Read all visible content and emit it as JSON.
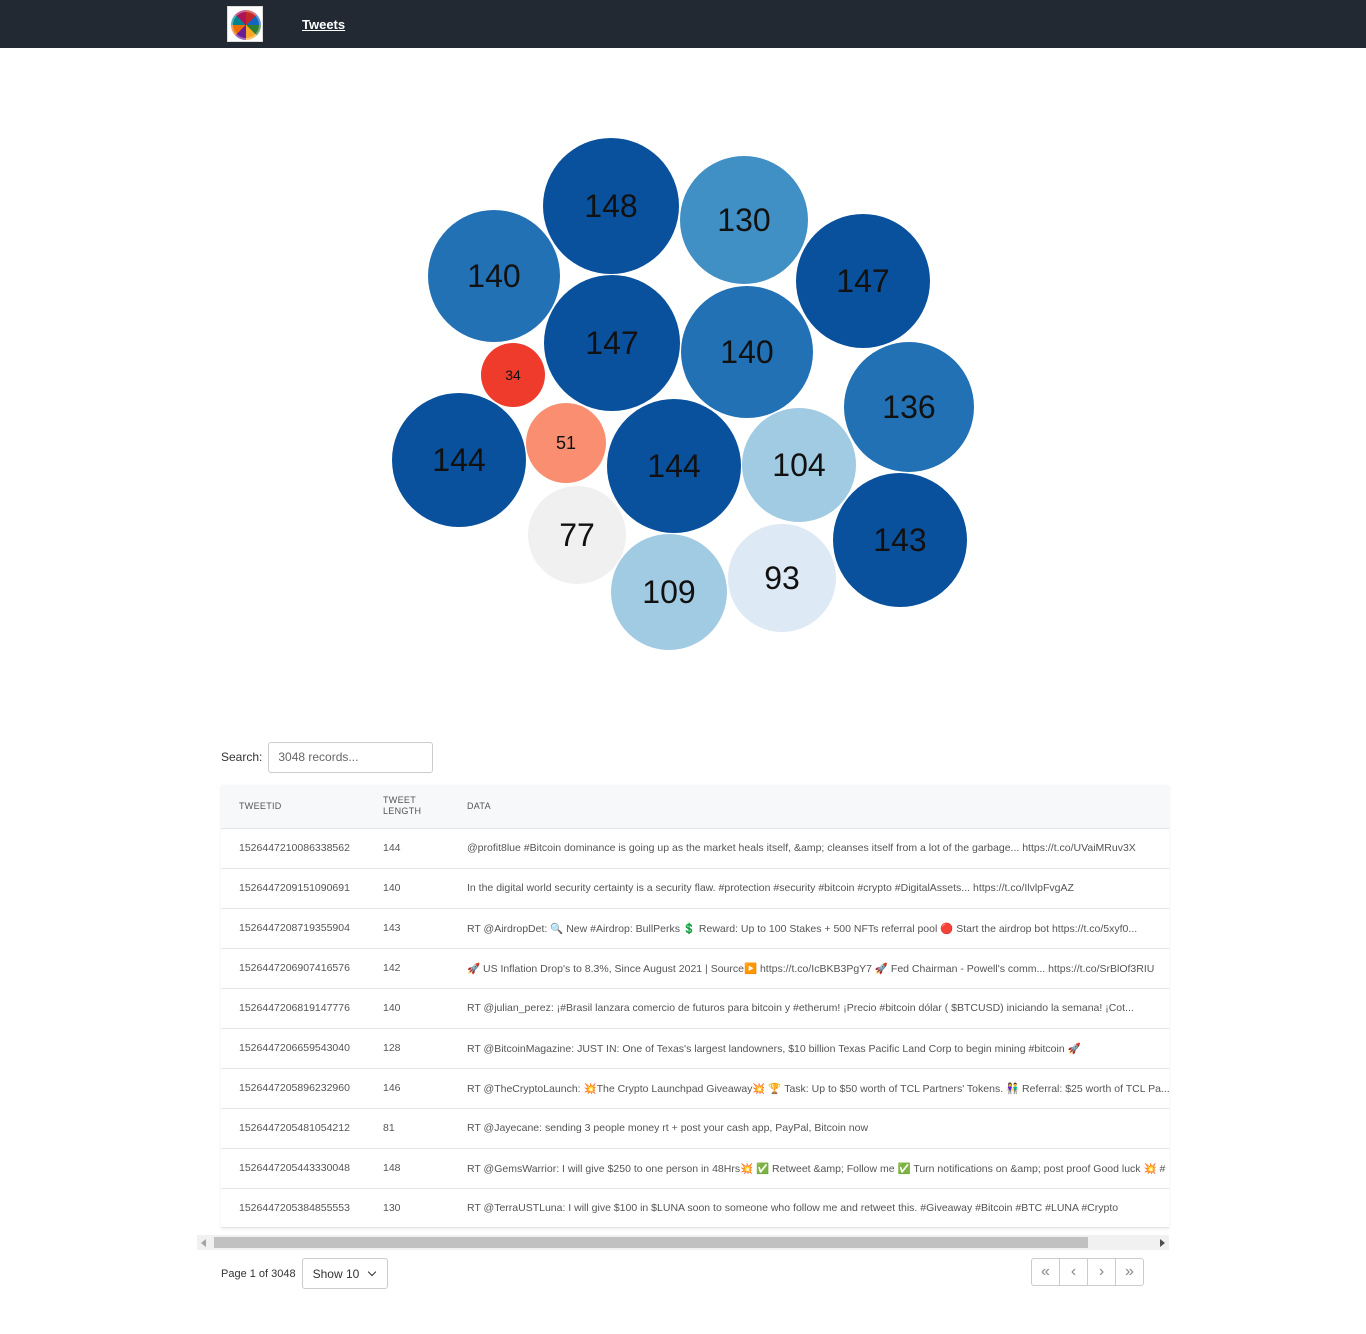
{
  "nav": {
    "logo_icon": "world-flags-globe-icon",
    "tweets_link": "Tweets"
  },
  "chart_data": {
    "type": "bubble",
    "values": [
      148,
      130,
      140,
      147,
      147,
      140,
      34,
      136,
      144,
      51,
      144,
      104,
      77,
      143,
      109,
      93
    ],
    "color_scale": "red-low / blue-high diverging"
  },
  "search": {
    "label": "Search:",
    "placeholder": "3048 records..."
  },
  "table": {
    "columns": [
      "TWEETID",
      "TWEET LENGTH",
      "DATA"
    ],
    "rows": [
      [
        "1526447210086338562",
        "144",
        "@profit8lue #Bitcoin  dominance is going up as the market heals itself, &amp; cleanses itself from a lot of the garbage... https://t.co/UVaiMRuv3X"
      ],
      [
        "1526447209151090691",
        "140",
        "In the digital world security certainty is a security flaw. #protection #security #bitcoin #crypto #DigitalAssets... https://t.co/IlvlpFvgAZ"
      ],
      [
        "1526447208719355904",
        "143",
        "RT @AirdropDet: 🔍 New #Airdrop: BullPerks 💲 Reward: Up to 100 Stakes + 500 NFTs referral pool 🔴 Start the airdrop bot https://t.co/5xyf0..."
      ],
      [
        "1526447206907416576",
        "142",
        "🚀 US Inflation Drop's to 8.3%, Since August 2021 | Source▶️ https://t.co/IcBKB3PgY7 🚀 Fed Chairman - Powell's comm... https://t.co/SrBlOf3RIU"
      ],
      [
        "1526447206819147776",
        "140",
        "RT @julian_perez: ¡#Brasil lanzara comercio de futuros para bitcoin y #etherum! ¡Precio #bitcoin dólar ( $BTCUSD) iniciando la semana! ¡Cot..."
      ],
      [
        "1526447206659543040",
        "128",
        "RT @BitcoinMagazine: JUST IN: One of Texas's largest landowners, $10 billion Texas Pacific Land Corp to begin mining #bitcoin 🚀"
      ],
      [
        "1526447205896232960",
        "146",
        "RT @TheCryptoLaunch: 💥The Crypto Launchpad Giveaway💥 🏆 Task: Up to $50 worth of TCL Partners' Tokens. 👫 Referral: $25 worth of TCL Pa..."
      ],
      [
        "1526447205481054212",
        "81",
        "RT @Jayecane: sending 3 people money rt + post your cash app, PayPal, Bitcoin now"
      ],
      [
        "1526447205443330048",
        "148",
        "RT @GemsWarrior: I will give $250 to one person in 48Hrs💥 ✅ Retweet &amp; Follow me ✅ Turn notifications on &amp; post proof Good luck 💥 #"
      ],
      [
        "1526447205384855553",
        "130",
        "RT @TerraUSTLuna: I will give $100 in $LUNA soon to someone who follow me and retweet this. #Giveaway #Bitcoin #BTC #LUNA #Crypto"
      ]
    ]
  },
  "pagination": {
    "page_info": "Page 1 of 3048",
    "show_label": "Show 10",
    "first": "«",
    "prev": "‹",
    "next": "›",
    "last": "»"
  }
}
